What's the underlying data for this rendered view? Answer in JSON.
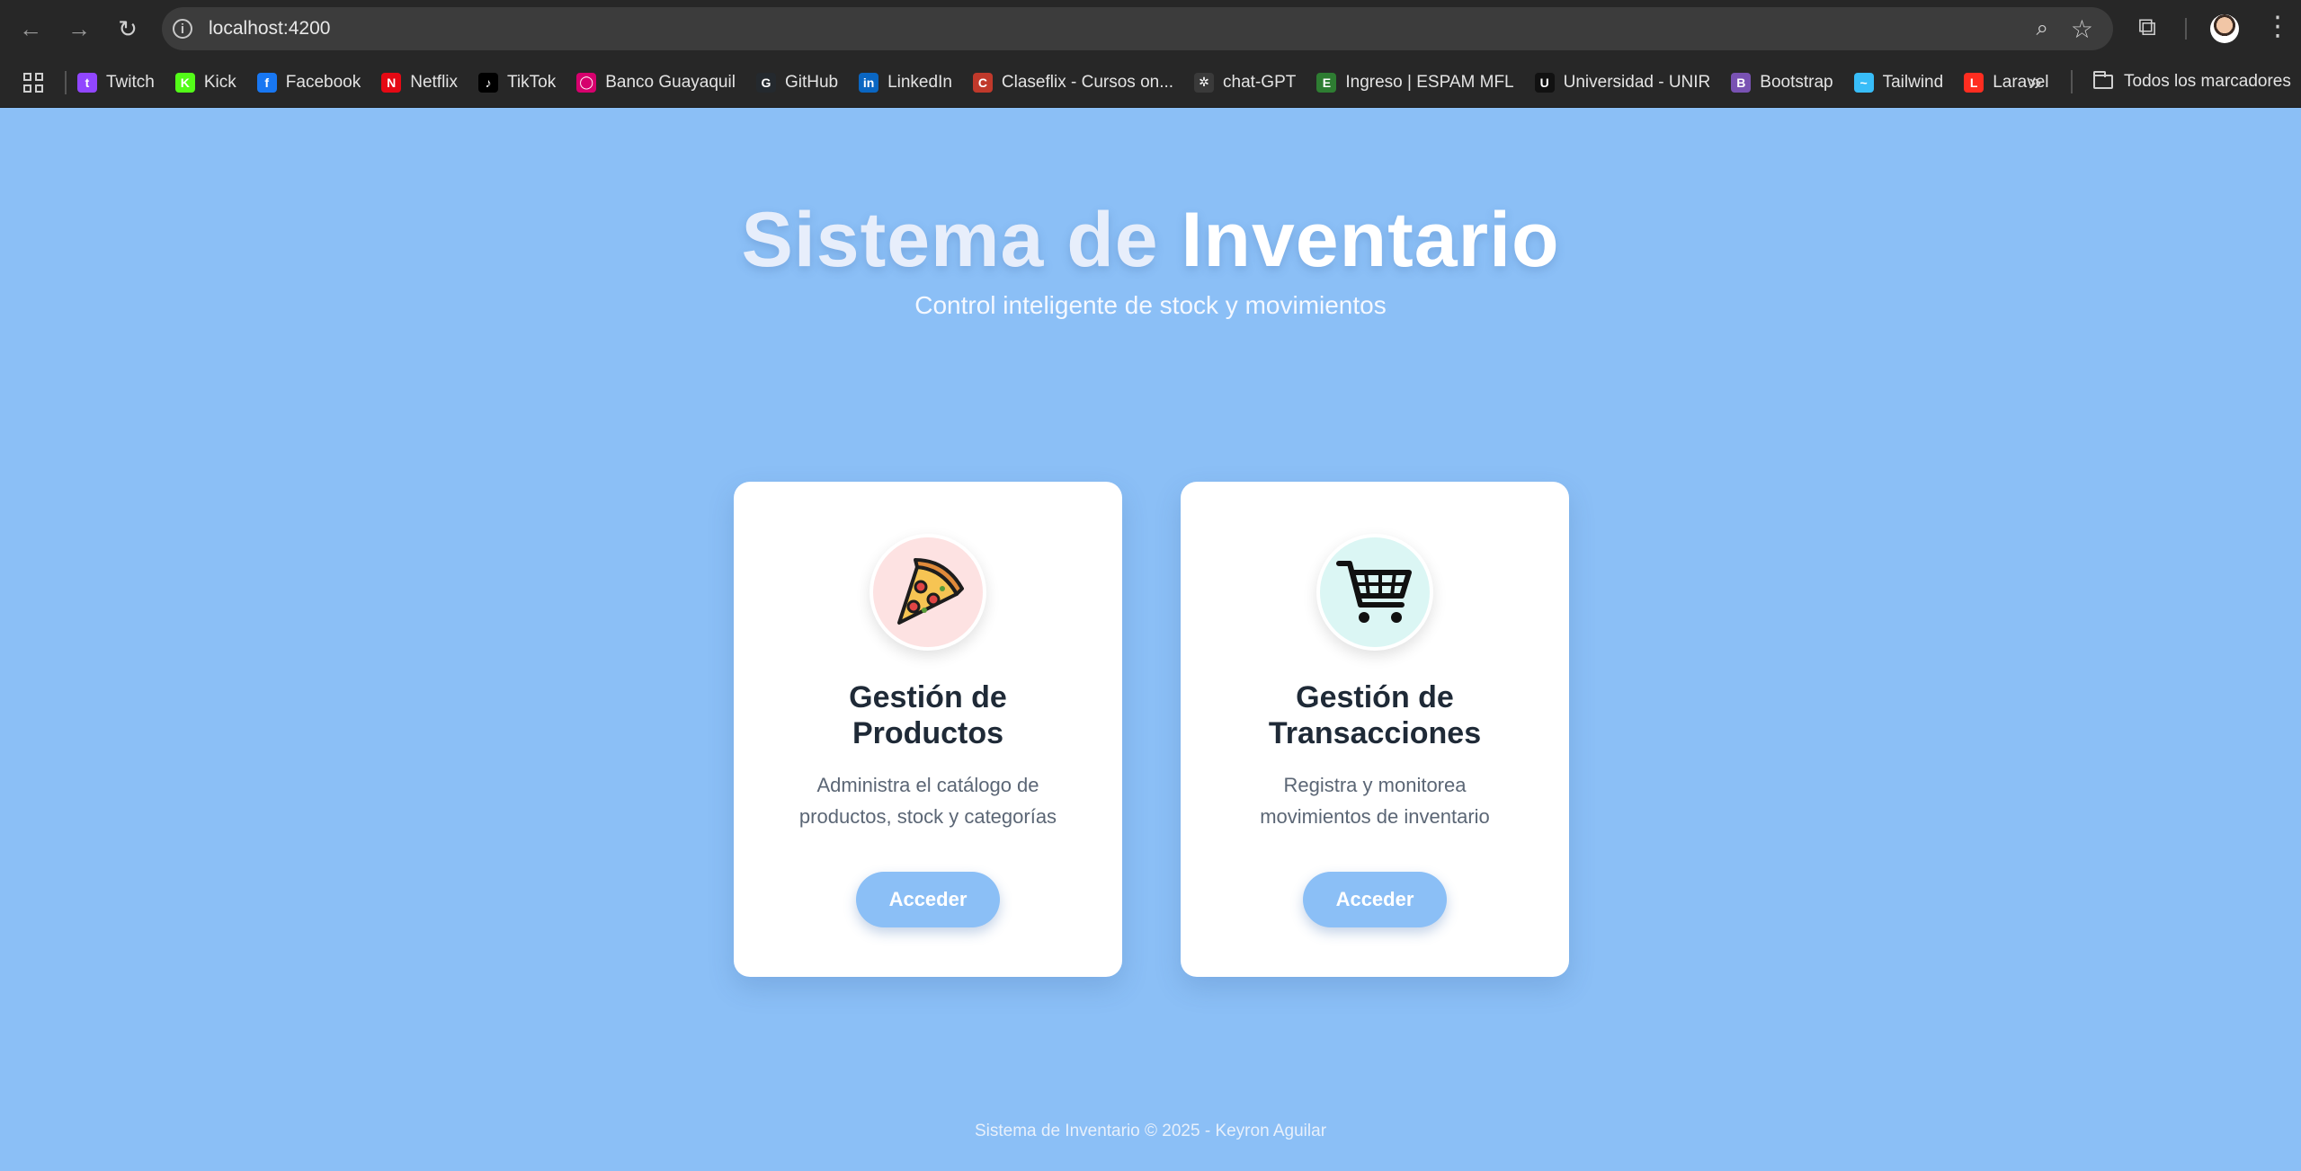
{
  "browser": {
    "url": "localhost:4200",
    "bookmarks": [
      {
        "label": "Twitch",
        "icon": "twitch-icon",
        "color": "#9146ff",
        "glyph": "t"
      },
      {
        "label": "Kick",
        "icon": "kick-icon",
        "color": "#53fc18",
        "glyph": "K"
      },
      {
        "label": "Facebook",
        "icon": "facebook-icon",
        "color": "#1877f2",
        "glyph": "f"
      },
      {
        "label": "Netflix",
        "icon": "netflix-icon",
        "color": "#e50914",
        "glyph": "N"
      },
      {
        "label": "TikTok",
        "icon": "tiktok-icon",
        "color": "#000000",
        "glyph": "♪"
      },
      {
        "label": "Banco Guayaquil",
        "icon": "banco-guayaquil-icon",
        "color": "#d6006d",
        "glyph": "◯"
      },
      {
        "label": "GitHub",
        "icon": "github-icon",
        "color": "#24292e",
        "glyph": "G"
      },
      {
        "label": "LinkedIn",
        "icon": "linkedin-icon",
        "color": "#0a66c2",
        "glyph": "in"
      },
      {
        "label": "Claseflix - Cursos on...",
        "icon": "claseflix-icon",
        "color": "#c0392b",
        "glyph": "C"
      },
      {
        "label": "chat-GPT",
        "icon": "chatgpt-icon",
        "color": "#3a3a3a",
        "glyph": "✲"
      },
      {
        "label": "Ingreso | ESPAM MFL",
        "icon": "espam-icon",
        "color": "#2e7d32",
        "glyph": "E"
      },
      {
        "label": "Universidad - UNIR",
        "icon": "unir-icon",
        "color": "#111111",
        "glyph": "U"
      },
      {
        "label": "Bootstrap",
        "icon": "bootstrap-icon",
        "color": "#7952b3",
        "glyph": "B"
      },
      {
        "label": "Tailwind",
        "icon": "tailwind-icon",
        "color": "#38bdf8",
        "glyph": "~"
      },
      {
        "label": "Laravel",
        "icon": "laravel-icon",
        "color": "#ff2d20",
        "glyph": "L"
      }
    ],
    "all_bookmarks": "Todos los marcadores"
  },
  "hero": {
    "title_part1": "Sistema de",
    "title_part2": "Inventario",
    "subtitle": "Control inteligente de stock y movimientos"
  },
  "cards": [
    {
      "icon": "pizza-icon",
      "title": "Gestión de Productos",
      "description": "Administra el catálogo de productos, stock y categorías",
      "button": "Acceder"
    },
    {
      "icon": "shopping-cart-icon",
      "title": "Gestión de Transacciones",
      "description": "Registra y monitorea movimientos de inventario",
      "button": "Acceder"
    }
  ],
  "footer": "Sistema de Inventario © 2025 - Keyron Aguilar",
  "colors": {
    "page_background": "#8bbff6",
    "pizza_circle": "#fde2e2",
    "cart_circle": "#dbf6f4",
    "button": "#8bbff6"
  }
}
